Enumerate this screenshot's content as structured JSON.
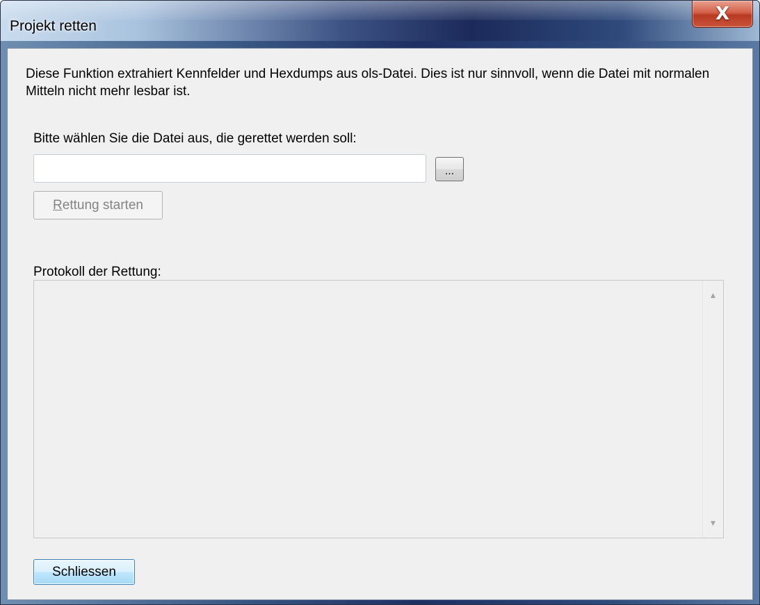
{
  "window": {
    "title": "Projekt retten",
    "close_symbol": "X"
  },
  "content": {
    "description": "Diese Funktion extrahiert Kennfelder und Hexdumps aus ols-Datei. Dies ist nur sinnvoll, wenn die Datei mit normalen Mitteln nicht mehr lesbar ist.",
    "file_label": "Bitte wählen Sie die Datei aus, die gerettet werden soll:",
    "file_value": "",
    "browse_label": "...",
    "start_label_accel": "R",
    "start_label_rest": "ettung starten",
    "log_label": "Protokoll der Rettung:",
    "log_text": "",
    "close_label": "Schliessen"
  },
  "icons": {
    "close": "close-icon",
    "scroll_up": "scroll-up-arrow-icon",
    "scroll_down": "scroll-down-arrow-icon"
  },
  "colors": {
    "dialog_background": "#f0f0f0",
    "close_button": "#c9543a",
    "disabled_text": "#838383",
    "default_button": "#a7d9f5"
  }
}
